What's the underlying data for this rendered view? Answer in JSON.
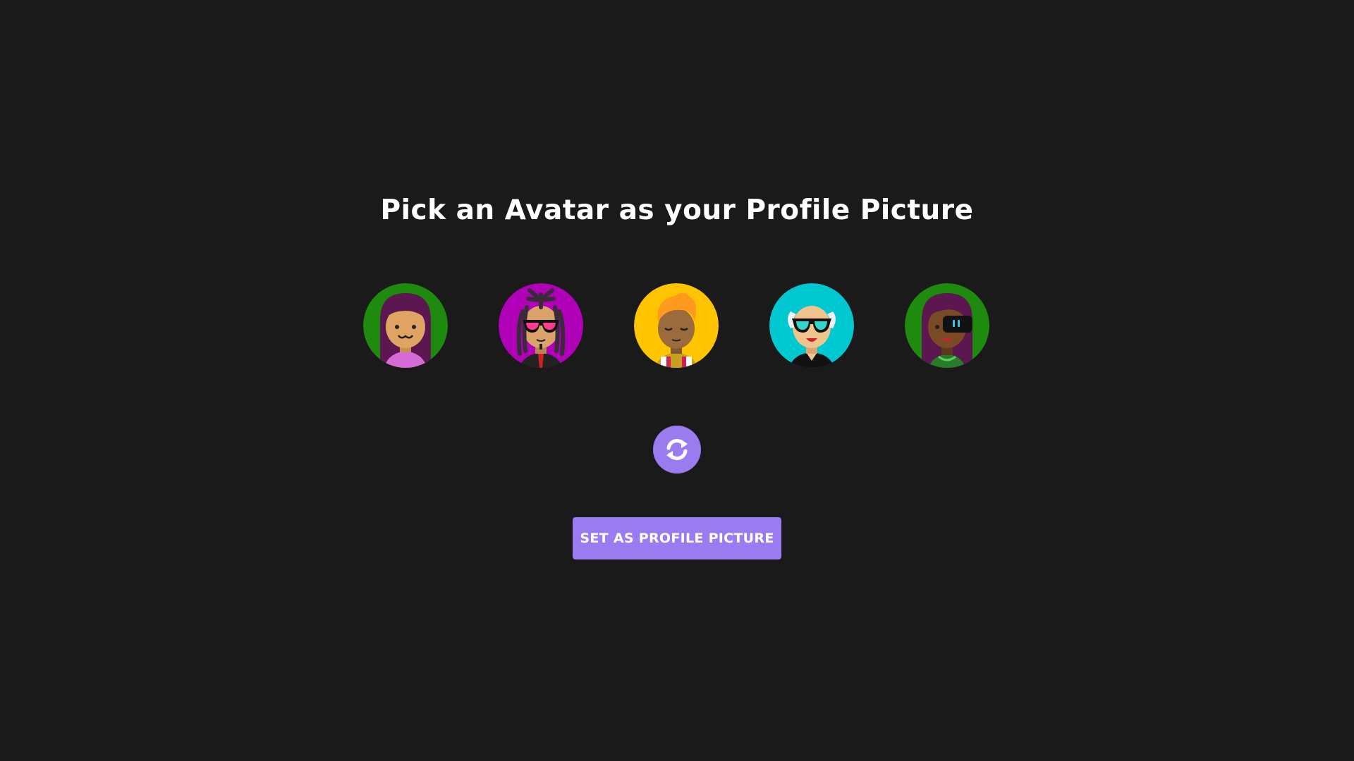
{
  "page": {
    "title": "Pick an Avatar as your Profile Picture"
  },
  "avatars": [
    {
      "name": "avatar-1",
      "background": "#1e8b0e",
      "hair": "#5c1650",
      "skin": "#e0a462",
      "shirt": "#d66bd6",
      "accessory": "smile"
    },
    {
      "name": "avatar-2",
      "background": "#b000b8",
      "hair": "#3a2a3a",
      "skin": "#d9a36a",
      "shirt": "#222222",
      "accessory": "pink-sunglasses"
    },
    {
      "name": "avatar-3",
      "background": "#ffc400",
      "hair": "#ff9a1f",
      "skin": "#9b6a3d",
      "shirt": "#ffffff",
      "accessory": "closed-eyes"
    },
    {
      "name": "avatar-4",
      "background": "#00c8d0",
      "hair": "#f0f0f0",
      "skin": "#f1c48e",
      "shirt": "#111111",
      "accessory": "teal-sunglasses"
    },
    {
      "name": "avatar-5",
      "background": "#1e8b0e",
      "hair": "#5c1650",
      "skin": "#7a4a26",
      "shirt": "#3aa03a",
      "accessory": "eyepatch"
    }
  ],
  "refresh": {
    "icon": "refresh-icon"
  },
  "actions": {
    "set_profile_label": "SET AS PROFILE PICTURE"
  },
  "colors": {
    "page_background": "#1a1a1a",
    "accent": "#9a7cf0",
    "text": "#ffffff"
  }
}
